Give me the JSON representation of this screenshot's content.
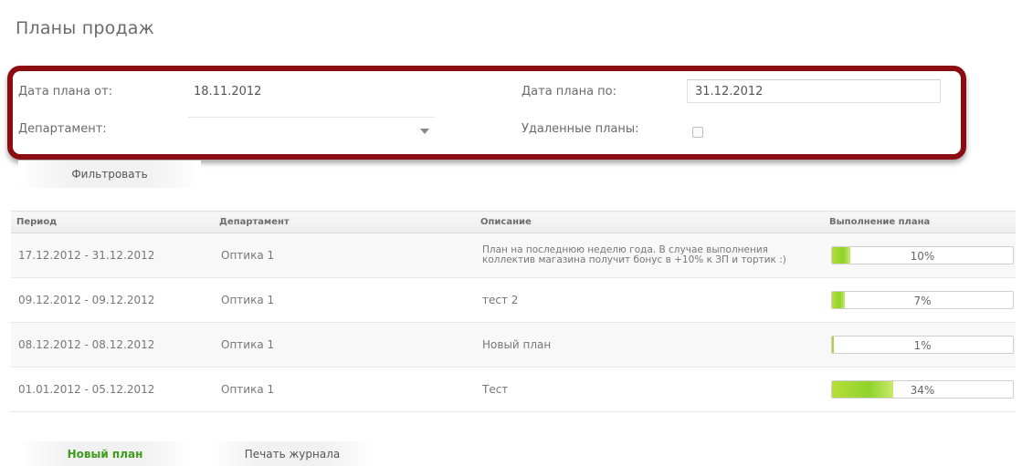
{
  "page": {
    "title": "Планы продаж"
  },
  "filters": {
    "date_from_label": "Дата плана от:",
    "date_from_value": "18.11.2012",
    "date_to_label": "Дата плана по:",
    "date_to_value": "31.12.2012",
    "department_label": "Департамент:",
    "department_value": "",
    "deleted_label": "Удаленные планы:",
    "deleted_checked": false,
    "filter_button": "Фильтровать"
  },
  "table": {
    "headers": [
      "Период",
      "Департамент",
      "Описание",
      "Выполнение плана"
    ],
    "rows": [
      {
        "period": "17.12.2012 - 31.12.2012",
        "department": "Оптика 1",
        "description": "План на последнюю неделю года. В случае выполнения коллектив магазина получит бонус в +10% к ЗП и тортик :)",
        "progress": 10,
        "progress_label": "10%"
      },
      {
        "period": "09.12.2012 - 09.12.2012",
        "department": "Оптика 1",
        "description": "тест 2",
        "progress": 7,
        "progress_label": "7%"
      },
      {
        "period": "08.12.2012 - 08.12.2012",
        "department": "Оптика 1",
        "description": "Новый план",
        "progress": 1,
        "progress_label": "1%"
      },
      {
        "period": "01.01.2012 - 05.12.2012",
        "department": "Оптика 1",
        "description": "Тест",
        "progress": 34,
        "progress_label": "34%"
      }
    ]
  },
  "actions": {
    "new_plan": "Новый план",
    "print_log": "Печать журнала"
  },
  "colors": {
    "highlight_border": "#8b0d12",
    "progress_fill": "#8fd22b",
    "new_plan_text": "#3f9b1c"
  }
}
